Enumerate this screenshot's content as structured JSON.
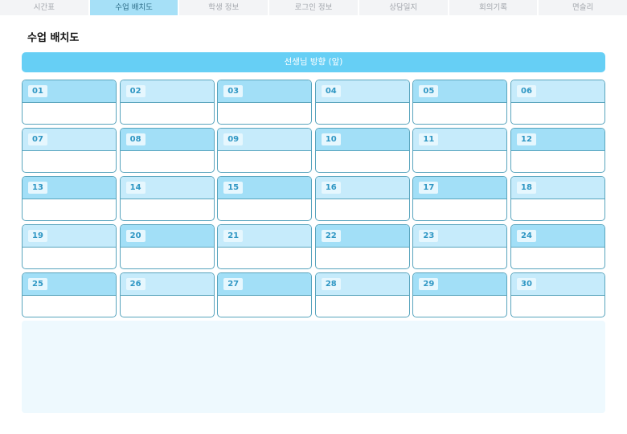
{
  "tabs": [
    {
      "label": "시간표",
      "active": false
    },
    {
      "label": "수업 배치도",
      "active": true
    },
    {
      "label": "학생 정보",
      "active": false
    },
    {
      "label": "로그인 정보",
      "active": false
    },
    {
      "label": "상담일지",
      "active": false
    },
    {
      "label": "회의기록",
      "active": false
    },
    {
      "label": "면슬리",
      "active": false
    }
  ],
  "page": {
    "title": "수업 배치도"
  },
  "banner": {
    "label": "선생님 방향 (앞)"
  },
  "desks": [
    {
      "number": "01",
      "shade": "dark"
    },
    {
      "number": "02",
      "shade": "light"
    },
    {
      "number": "03",
      "shade": "dark"
    },
    {
      "number": "04",
      "shade": "light"
    },
    {
      "number": "05",
      "shade": "dark"
    },
    {
      "number": "06",
      "shade": "light"
    },
    {
      "number": "07",
      "shade": "light"
    },
    {
      "number": "08",
      "shade": "dark"
    },
    {
      "number": "09",
      "shade": "light"
    },
    {
      "number": "10",
      "shade": "dark"
    },
    {
      "number": "11",
      "shade": "light"
    },
    {
      "number": "12",
      "shade": "dark"
    },
    {
      "number": "13",
      "shade": "dark"
    },
    {
      "number": "14",
      "shade": "light"
    },
    {
      "number": "15",
      "shade": "dark"
    },
    {
      "number": "16",
      "shade": "light"
    },
    {
      "number": "17",
      "shade": "dark"
    },
    {
      "number": "18",
      "shade": "light"
    },
    {
      "number": "19",
      "shade": "light"
    },
    {
      "number": "20",
      "shade": "dark"
    },
    {
      "number": "21",
      "shade": "light"
    },
    {
      "number": "22",
      "shade": "dark"
    },
    {
      "number": "23",
      "shade": "light"
    },
    {
      "number": "24",
      "shade": "dark"
    },
    {
      "number": "25",
      "shade": "dark"
    },
    {
      "number": "26",
      "shade": "light"
    },
    {
      "number": "27",
      "shade": "dark"
    },
    {
      "number": "28",
      "shade": "light"
    },
    {
      "number": "29",
      "shade": "dark"
    },
    {
      "number": "30",
      "shade": "light"
    }
  ],
  "colors": {
    "accent": "#66cff5",
    "tab_active_bg": "#a6e0f7",
    "desk_head_dark": "#a2dff7",
    "desk_head_light": "#c6ebfb",
    "desk_border": "#58a4bd"
  }
}
